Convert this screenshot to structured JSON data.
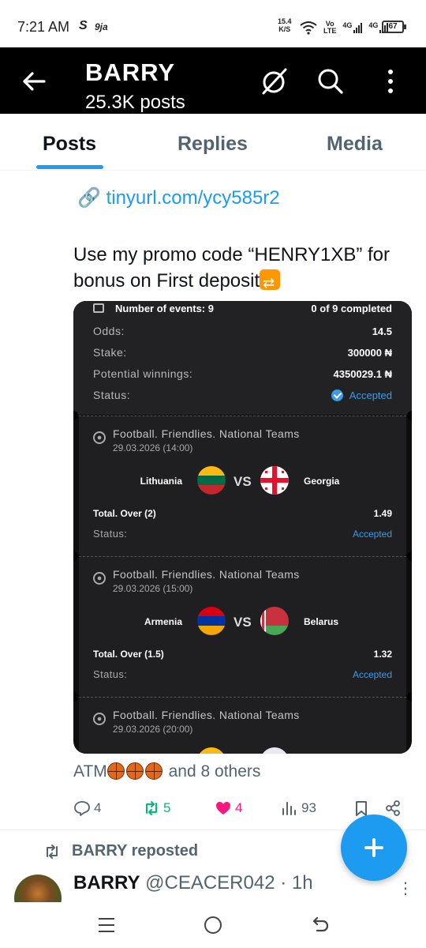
{
  "status_bar": {
    "time": "7:21 AM",
    "icon_s": "S",
    "icon_9ja": "9ja",
    "speed_value": "15.4",
    "speed_unit": "K/S",
    "volte_top": "Vo",
    "volte_bottom": "LTE",
    "net1": "4G",
    "net2": "4G",
    "battery": "67",
    "icons": [
      "wifi-icon",
      "signal-icon",
      "battery-icon"
    ]
  },
  "header": {
    "title": "BARRY",
    "subtitle": "25.3K posts",
    "icons": [
      "back-arrow-icon",
      "grok-icon",
      "search-icon",
      "more-vertical-icon"
    ]
  },
  "tabs": [
    {
      "label": "Posts",
      "active": true
    },
    {
      "label": "Replies",
      "active": false
    },
    {
      "label": "Media",
      "active": false
    }
  ],
  "post": {
    "link_emoji": "🔗",
    "link_text": "tinyurl.com/ycy585r2",
    "text": "Use my promo code “HENRY1XB” for bonus on First deposit",
    "bet_card": {
      "events_label": "Number of events: 9",
      "completed": "0 of 9 completed",
      "odds_label": "Odds:",
      "odds_value": "14.5",
      "stake_label": "Stake:",
      "stake_value": "300000 ₦",
      "winnings_label": "Potential winnings:",
      "winnings_value": "4350029.1 ₦",
      "status_label": "Status:",
      "status_value": "Accepted",
      "events": [
        {
          "league": "Football. Friendlies. National Teams",
          "date": "29.03.2026 (14:00)",
          "team1": "Lithuania",
          "team2": "Georgia",
          "vs": "VS",
          "bet": "Total. Over (2)",
          "odd": "1.49",
          "status_label": "Status:",
          "status": "Accepted"
        },
        {
          "league": "Football. Friendlies. National Teams",
          "date": "29.03.2026 (15:00)",
          "team1": "Armenia",
          "team2": "Belarus",
          "vs": "VS",
          "bet": "Total. Over (1.5)",
          "odd": "1.32",
          "status_label": "Status:",
          "status": "Accepted"
        },
        {
          "league": "Football. Friendlies. National Teams",
          "date": "29.03.2026 (20:00)"
        }
      ]
    },
    "liked_prefix": "ATM",
    "liked_suffix": "and 8 others",
    "actions": {
      "replies": "4",
      "reposts": "5",
      "likes": "4",
      "views": "93"
    }
  },
  "next_post": {
    "reposted_by": "BARRY reposted",
    "author_name": "BARRY",
    "author_handle": "@CEACER042",
    "time": "· 1h"
  },
  "colors": {
    "accent": "#1d9bf0",
    "repost_green": "#00ba7c",
    "like_pink": "#f91880",
    "muted": "#536471",
    "accepted_blue": "#3b9be8"
  }
}
